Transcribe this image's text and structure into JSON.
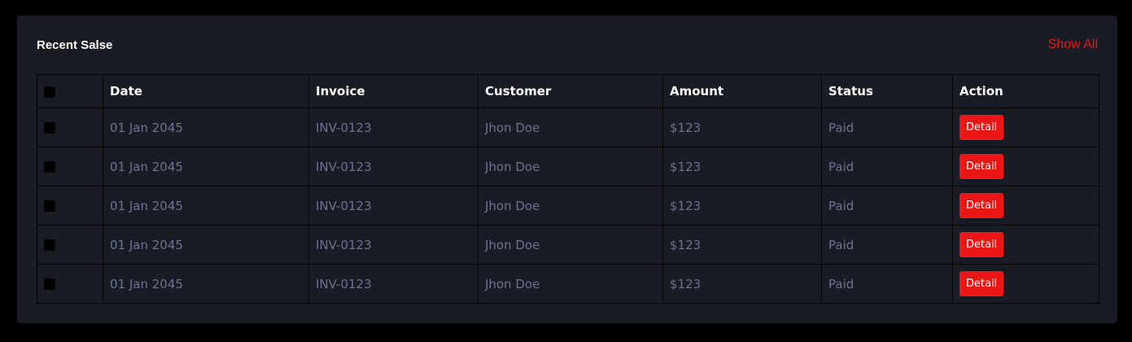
{
  "card": {
    "title": "Recent Salse",
    "show_all_label": "Show All"
  },
  "table": {
    "columns": [
      "",
      "Date",
      "Invoice",
      "Customer",
      "Amount",
      "Status",
      "Action"
    ],
    "rows": [
      {
        "date": "01 Jan 2045",
        "invoice": "INV-0123",
        "customer": "Jhon Doe",
        "amount": "$123",
        "status": "Paid",
        "action": "Detail"
      },
      {
        "date": "01 Jan 2045",
        "invoice": "INV-0123",
        "customer": "Jhon Doe",
        "amount": "$123",
        "status": "Paid",
        "action": "Detail"
      },
      {
        "date": "01 Jan 2045",
        "invoice": "INV-0123",
        "customer": "Jhon Doe",
        "amount": "$123",
        "status": "Paid",
        "action": "Detail"
      },
      {
        "date": "01 Jan 2045",
        "invoice": "INV-0123",
        "customer": "Jhon Doe",
        "amount": "$123",
        "status": "Paid",
        "action": "Detail"
      },
      {
        "date": "01 Jan 2045",
        "invoice": "INV-0123",
        "customer": "Jhon Doe",
        "amount": "$123",
        "status": "Paid",
        "action": "Detail"
      }
    ]
  },
  "colors": {
    "accent": "#eb1616",
    "panel_bg": "#191c24",
    "page_bg": "#000000",
    "muted_text": "#6c7293"
  }
}
